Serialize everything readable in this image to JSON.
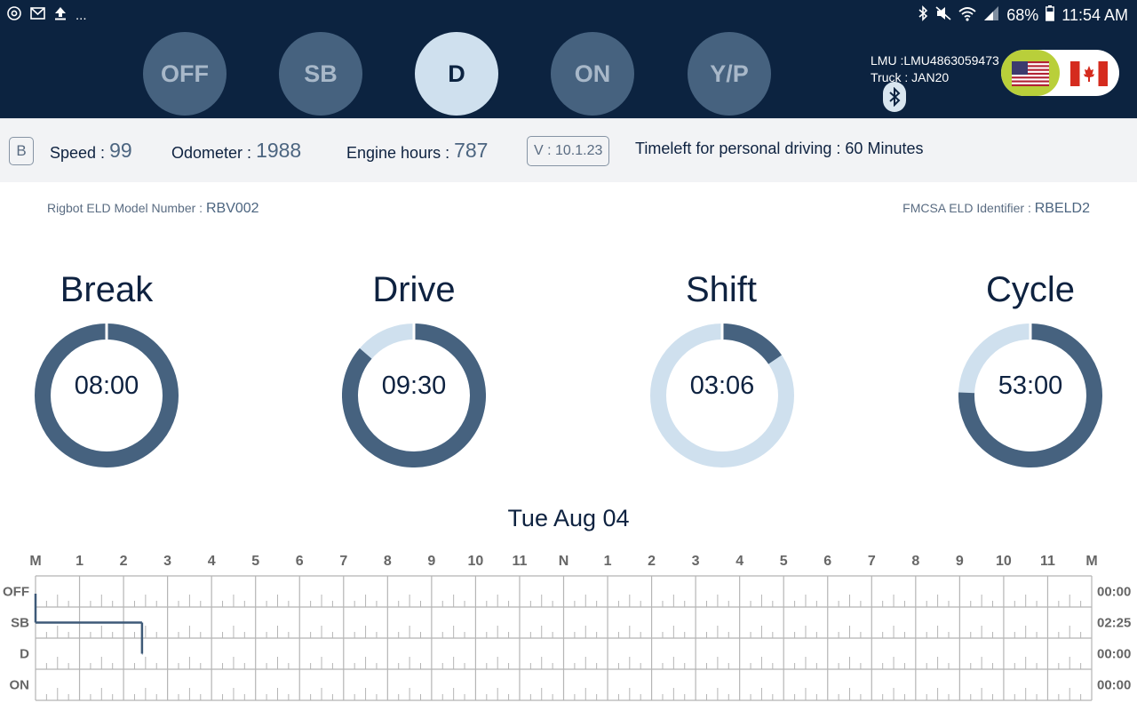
{
  "status_bar": {
    "left_icons": [
      "at-icon",
      "mail-icon",
      "upload-icon"
    ],
    "more": "...",
    "battery": "68%",
    "time": "11:54 AM"
  },
  "duty_status": {
    "buttons": [
      {
        "label": "OFF",
        "active": false
      },
      {
        "label": "SB",
        "active": false
      },
      {
        "label": "D",
        "active": true
      },
      {
        "label": "ON",
        "active": false
      },
      {
        "label": "Y/P",
        "active": false
      }
    ]
  },
  "device": {
    "lmu_label": "LMU :",
    "lmu_value": "LMU4863059473",
    "truck_label": "Truck :",
    "truck_value": "JAN20"
  },
  "info_bar": {
    "badge": "B",
    "speed_label": "Speed :",
    "speed_value": "99",
    "odometer_label": "Odometer :",
    "odometer_value": "1988",
    "engine_label": "Engine hours :",
    "engine_value": "787",
    "version": "V : 10.1.23",
    "timeleft": "Timeleft for personal driving : 60 Minutes"
  },
  "model": {
    "model_label": "Rigbot ELD Model Number :",
    "model_value": "RBV002",
    "fmcsa_label": "FMCSA ELD Identifier :",
    "fmcsa_value": "RBELD2"
  },
  "gauges": [
    {
      "title": "Break",
      "time": "08:00",
      "fraction": 1.0
    },
    {
      "title": "Drive",
      "time": "09:30",
      "fraction": 0.864
    },
    {
      "title": "Shift",
      "time": "03:06",
      "fraction": 0.155
    },
    {
      "title": "Cycle",
      "time": "53:00",
      "fraction": 0.757
    }
  ],
  "log": {
    "date": "Tue Aug 04",
    "hour_labels": [
      "M",
      "1",
      "2",
      "3",
      "4",
      "5",
      "6",
      "7",
      "8",
      "9",
      "10",
      "11",
      "N",
      "1",
      "2",
      "3",
      "4",
      "5",
      "6",
      "7",
      "8",
      "9",
      "10",
      "11",
      "M"
    ],
    "rows": [
      {
        "label": "OFF",
        "total": "00:00"
      },
      {
        "label": "SB",
        "total": "02:25"
      },
      {
        "label": "D",
        "total": "00:00"
      },
      {
        "label": "ON",
        "total": "00:00"
      }
    ],
    "segments": [
      {
        "row": 1,
        "start_hour": 0.0,
        "end_hour": 2.42
      },
      {
        "row": 2,
        "start_hour": 2.42,
        "end_hour": 2.42
      }
    ]
  },
  "colors": {
    "header_bg": "#0c2340",
    "button_inactive": "#46627f",
    "button_active": "#cfe0ee",
    "gauge_fill": "#46627f",
    "gauge_track": "#cfe0ee",
    "flag_selected": "#b9cf3a"
  }
}
